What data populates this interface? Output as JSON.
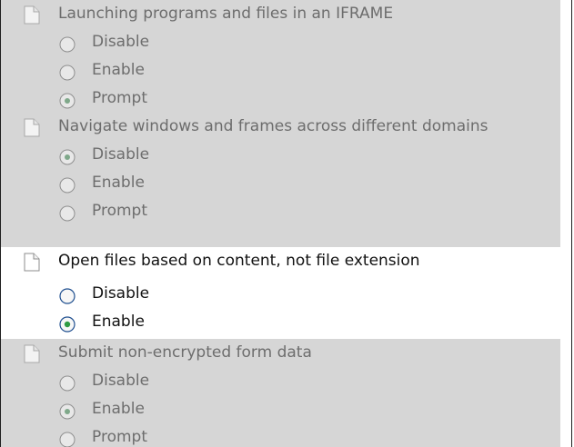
{
  "settings": [
    {
      "label": "Launching programs and files in an IFRAME",
      "state": "disabled",
      "options": [
        {
          "label": "Disable",
          "selected": false
        },
        {
          "label": "Enable",
          "selected": false
        },
        {
          "label": "Prompt",
          "selected": true
        }
      ]
    },
    {
      "label": "Navigate windows and frames across different domains",
      "state": "disabled",
      "options": [
        {
          "label": "Disable",
          "selected": true
        },
        {
          "label": "Enable",
          "selected": false
        },
        {
          "label": "Prompt",
          "selected": false
        }
      ]
    },
    {
      "label": "Open files based on content, not file extension",
      "state": "enabled",
      "options": [
        {
          "label": "Disable",
          "selected": false
        },
        {
          "label": "Enable",
          "selected": true
        }
      ]
    },
    {
      "label": "Submit non-encrypted form data",
      "state": "disabled",
      "options": [
        {
          "label": "Disable",
          "selected": false
        },
        {
          "label": "Enable",
          "selected": true
        },
        {
          "label": "Prompt",
          "selected": false
        }
      ]
    }
  ],
  "colors": {
    "disabled_background": "#d6d6d6",
    "disabled_text": "#6d6d6d",
    "enabled_background": "#ffffff",
    "enabled_text": "#111111",
    "radio_border_enabled": "#1f4f8f",
    "radio_fill_enabled": "#2f9b43",
    "radio_border_disabled": "#8f8f8f",
    "radio_fill_disabled": "#7fa88a"
  }
}
